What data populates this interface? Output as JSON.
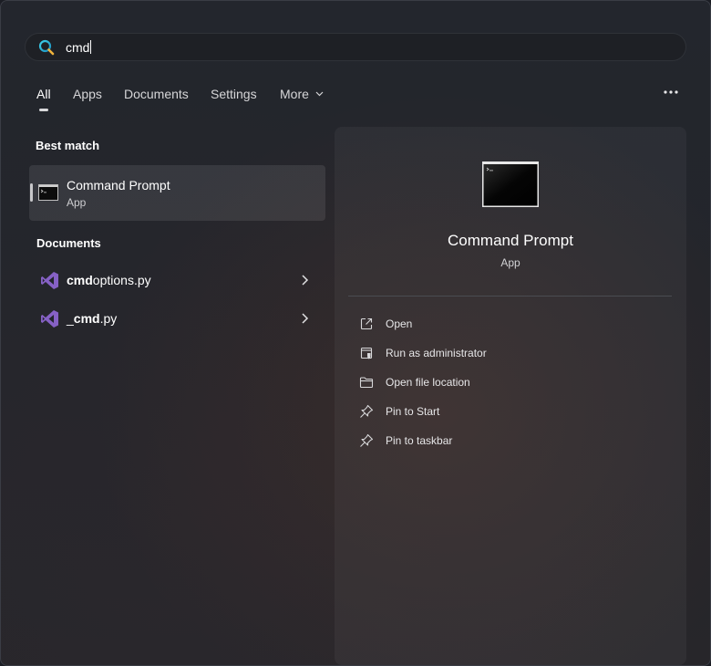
{
  "search": {
    "query": "cmd"
  },
  "tabs": [
    {
      "label": "All",
      "active": true
    },
    {
      "label": "Apps"
    },
    {
      "label": "Documents"
    },
    {
      "label": "Settings"
    },
    {
      "label": "More"
    }
  ],
  "best_match": {
    "heading": "Best match",
    "item": {
      "name": "Command Prompt",
      "type": "App",
      "icon": "command-prompt-icon"
    }
  },
  "documents": {
    "heading": "Documents",
    "items": [
      {
        "name_bold": "cmd",
        "name_rest": "options.py",
        "icon": "visual-studio-icon"
      },
      {
        "name_prefix": "_",
        "name_bold": "cmd",
        "name_rest": ".py",
        "icon": "visual-studio-icon"
      }
    ]
  },
  "detail": {
    "title": "Command Prompt",
    "subtitle": "App",
    "actions": [
      {
        "label": "Open",
        "icon": "open-external-icon"
      },
      {
        "label": "Run as administrator",
        "icon": "shield-window-icon"
      },
      {
        "label": "Open file location",
        "icon": "folder-icon"
      },
      {
        "label": "Pin to Start",
        "icon": "pin-icon"
      },
      {
        "label": "Pin to taskbar",
        "icon": "pin-icon"
      }
    ]
  },
  "colors": {
    "accent_search": "#2fb4d4",
    "vs_purple": "#8661c5",
    "panel_bg": "#23262d"
  }
}
